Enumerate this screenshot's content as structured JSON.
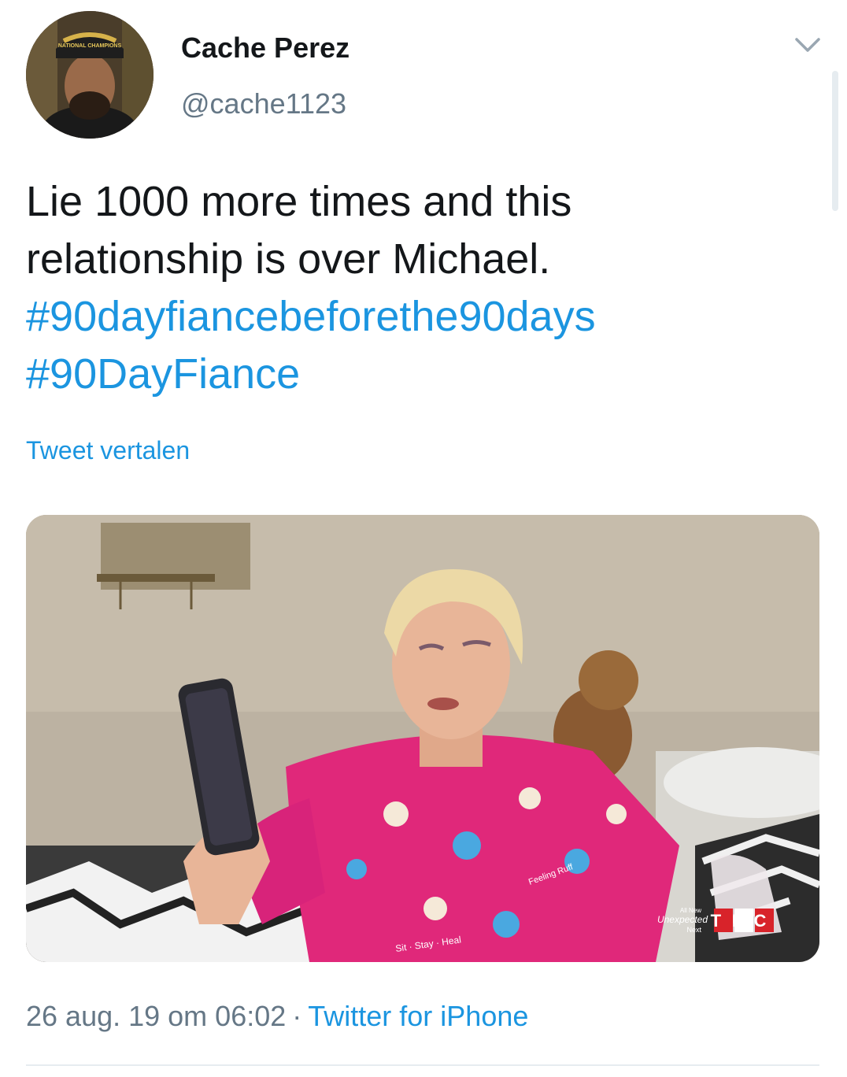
{
  "author": {
    "name": "Cache Perez",
    "handle": "@cache1123",
    "avatar_cap_text": "NATIONAL CHAMPIONS"
  },
  "tweet": {
    "text_lines": [
      "Lie 1000 more times and this",
      "relationship is over Michael."
    ],
    "hashtags": [
      "#90dayfiancebeforethe90days",
      "#90DayFiance"
    ],
    "translate_label": "Tweet vertalen",
    "timestamp": "26 aug. 19 om 06:02",
    "separator": "·",
    "source": "Twitter for iPhone"
  },
  "media": {
    "watermark": "TLC",
    "promo_line1": "All New",
    "promo_line2": "Unexpected",
    "promo_line3": "Next",
    "shirt_text_1": "Sit · Stay · Heal",
    "shirt_text_2": "Feeling Ruff"
  },
  "colors": {
    "link": "#1b95e0",
    "secondary_text": "#657786",
    "primary_text": "#14171a",
    "shirt_pink": "#e0287a",
    "tlc_red": "#d8232a"
  },
  "icons": {
    "menu": "chevron-down-icon"
  }
}
